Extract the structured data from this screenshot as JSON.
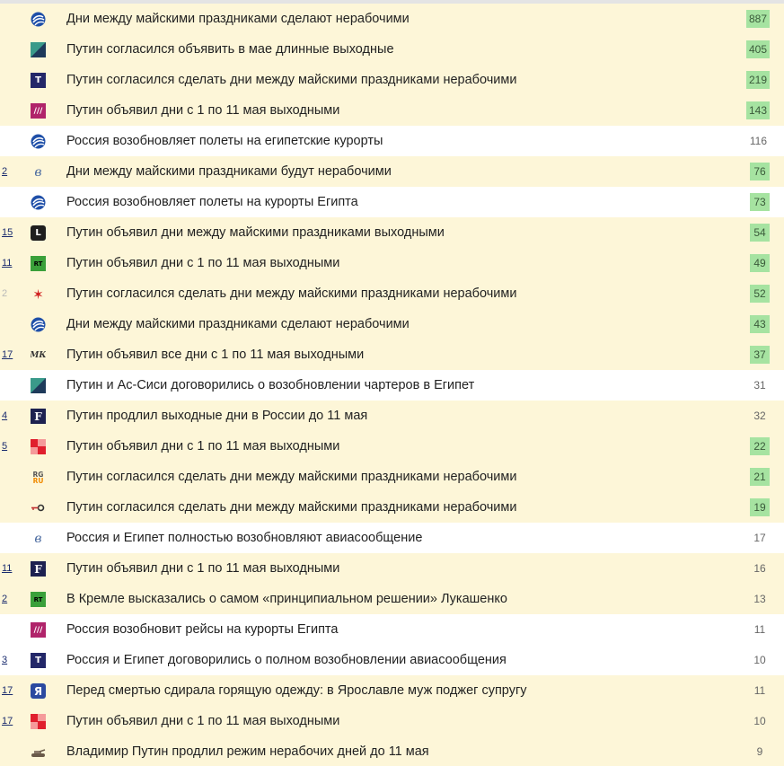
{
  "items": [
    {
      "rank": "",
      "rank_pale": false,
      "source_icon": "kommersant-globe-icon",
      "title": "Дни между майскими праздниками сделают нерабочими",
      "count": "887",
      "highlight": true,
      "count_green": true
    },
    {
      "rank": "",
      "rank_pale": false,
      "source_icon": "izvestia-icon",
      "title": "Путин согласился объявить в мае длинные выходные",
      "count": "405",
      "highlight": true,
      "count_green": true
    },
    {
      "rank": "",
      "rank_pale": false,
      "source_icon": "tass-t-icon",
      "title": "Путин согласился сделать дни между майскими праздниками нерабочими",
      "count": "219",
      "highlight": true,
      "count_green": true
    },
    {
      "rank": "",
      "rank_pale": false,
      "source_icon": "rain-icon",
      "title": "Путин объявил дни с 1 по 11 мая выходными",
      "count": "143",
      "highlight": true,
      "count_green": true
    },
    {
      "rank": "",
      "rank_pale": false,
      "source_icon": "kommersant-globe-icon",
      "title": "Россия возобновляет полеты на египетские курорты",
      "count": "116",
      "highlight": false,
      "count_green": false
    },
    {
      "rank": "2",
      "rank_pale": false,
      "source_icon": "vedomosti-icon",
      "title": "Дни между майскими праздниками будут нерабочими",
      "count": "76",
      "highlight": true,
      "count_green": true
    },
    {
      "rank": "",
      "rank_pale": false,
      "source_icon": "kommersant-globe-icon",
      "title": "Россия возобновляет полеты на курорты Египта",
      "count": "73",
      "highlight": false,
      "count_green": true
    },
    {
      "rank": "15",
      "rank_pale": false,
      "source_icon": "lenta-l-icon",
      "title": "Путин объявил дни между майскими праздниками выходными",
      "count": "54",
      "highlight": true,
      "count_green": true
    },
    {
      "rank": "11",
      "rank_pale": false,
      "source_icon": "rt-icon",
      "title": "Путин объявил дни с 1 по 11 мая выходными",
      "count": "49",
      "highlight": true,
      "count_green": true
    },
    {
      "rank": "2",
      "rank_pale": true,
      "source_icon": "zvezda-star-icon",
      "title": "Путин согласился сделать дни между майскими праздниками нерабочими",
      "count": "52",
      "highlight": true,
      "count_green": true
    },
    {
      "rank": "",
      "rank_pale": false,
      "source_icon": "kommersant-globe-icon",
      "title": "Дни между майскими праздниками сделают нерабочими",
      "count": "43",
      "highlight": true,
      "count_green": true
    },
    {
      "rank": "17",
      "rank_pale": false,
      "source_icon": "mk-icon",
      "title": "Путин объявил все дни с 1 по 11 мая выходными",
      "count": "37",
      "highlight": true,
      "count_green": true
    },
    {
      "rank": "",
      "rank_pale": false,
      "source_icon": "izvestia-icon",
      "title": "Путин и Ас-Сиси договорились о возобновлении чартеров в Египет",
      "count": "31",
      "highlight": false,
      "count_green": false
    },
    {
      "rank": "4",
      "rank_pale": false,
      "source_icon": "forbes-f-icon",
      "title": "Путин продлил выходные дни в России до 11 мая",
      "count": "32",
      "highlight": true,
      "count_green": false
    },
    {
      "rank": "5",
      "rank_pale": false,
      "source_icon": "rbc-squares-icon",
      "title": "Путин объявил дни с 1 по 11 мая выходными",
      "count": "22",
      "highlight": true,
      "count_green": true
    },
    {
      "rank": "",
      "rank_pale": false,
      "source_icon": "rg-ru-icon",
      "title": "Путин согласился сделать дни между майскими праздниками нерабочими",
      "count": "21",
      "highlight": true,
      "count_green": true
    },
    {
      "rank": "",
      "rank_pale": false,
      "source_icon": "key-icon",
      "title": "Путин согласился сделать дни между майскими праздниками нерабочими",
      "count": "19",
      "highlight": true,
      "count_green": true
    },
    {
      "rank": "",
      "rank_pale": false,
      "source_icon": "vedomosti-icon",
      "title": "Россия и Египет полностью возобновляют авиасообщение",
      "count": "17",
      "highlight": false,
      "count_green": false
    },
    {
      "rank": "11",
      "rank_pale": false,
      "source_icon": "forbes-f-icon",
      "title": "Путин объявил дни с 1 по 11 мая выходными",
      "count": "16",
      "highlight": true,
      "count_green": false
    },
    {
      "rank": "2",
      "rank_pale": false,
      "source_icon": "rt-icon",
      "title": "В Кремле высказались о самом «принципиальном решении» Лукашенко",
      "count": "13",
      "highlight": true,
      "count_green": false
    },
    {
      "rank": "",
      "rank_pale": false,
      "source_icon": "rain-icon",
      "title": "Россия возобновит рейсы на курорты Египта",
      "count": "11",
      "highlight": false,
      "count_green": false
    },
    {
      "rank": "3",
      "rank_pale": false,
      "source_icon": "tass-t-icon",
      "title": "Россия и Египет договорились о полном возобновлении авиасообщения",
      "count": "10",
      "highlight": false,
      "count_green": false
    },
    {
      "rank": "17",
      "rank_pale": false,
      "source_icon": "yaroslavl-ya-icon",
      "title": "Перед смертью сдирала горящую одежду: в Ярославле муж поджег супругу",
      "count": "11",
      "highlight": true,
      "count_green": false
    },
    {
      "rank": "17",
      "rank_pale": false,
      "source_icon": "rbc-squares-icon",
      "title": "Путин объявил дни с 1 по 11 мая выходными",
      "count": "10",
      "highlight": true,
      "count_green": false
    },
    {
      "rank": "",
      "rank_pale": false,
      "source_icon": "tank-icon",
      "title": "Владимир Путин продлил режим нерабочих дней до 11 мая",
      "count": "9",
      "highlight": true,
      "count_green": false
    }
  ],
  "logo_text": {
    "tass": "T",
    "lenta": "L",
    "rt": "RT",
    "forbes": "F",
    "yaroslavl": "Я",
    "rg_top": "RG",
    "rg_bottom": "RU",
    "mk": "МК",
    "rain": "///"
  },
  "colors": {
    "highlight_bg": "#fdf6d8",
    "count_green": "#a6e3a1",
    "rank_link": "#1a2b6e"
  }
}
